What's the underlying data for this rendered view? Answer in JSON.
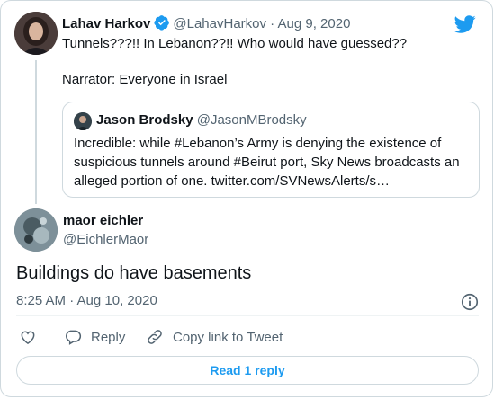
{
  "colors": {
    "accent": "#1d9bf0",
    "muted": "#536471",
    "border": "#cfd9de",
    "text": "#0f1419"
  },
  "icons": {
    "logo": "twitter-bird-icon",
    "verified": "verified-badge-icon",
    "info": "info-icon",
    "like": "heart-icon",
    "reply": "reply-icon",
    "copy": "link-icon"
  },
  "parent": {
    "name": "Lahav Harkov",
    "handle": "@LahavHarkov",
    "separator": "·",
    "date": "Aug 9, 2020",
    "line1": "Tunnels???!! In Lebanon??!! Who would have guessed??",
    "line2": "Narrator: Everyone in Israel"
  },
  "quote": {
    "name": "Jason Brodsky",
    "handle": "@JasonMBrodsky",
    "text": "Incredible: while #Lebanon’s Army is denying the existence of suspicious tunnels around #Beirut port, Sky News broadcasts an alleged portion of one. twitter.com/SVNewsAlerts/s…"
  },
  "reply": {
    "name": "maor eichler",
    "handle": "@EichlerMaor",
    "text": "Buildings do have basements",
    "timestamp": "8:25 AM · Aug 10, 2020"
  },
  "actions": {
    "reply_label": "Reply",
    "copy_label": "Copy link to Tweet"
  },
  "read_replies_label": "Read 1 reply"
}
